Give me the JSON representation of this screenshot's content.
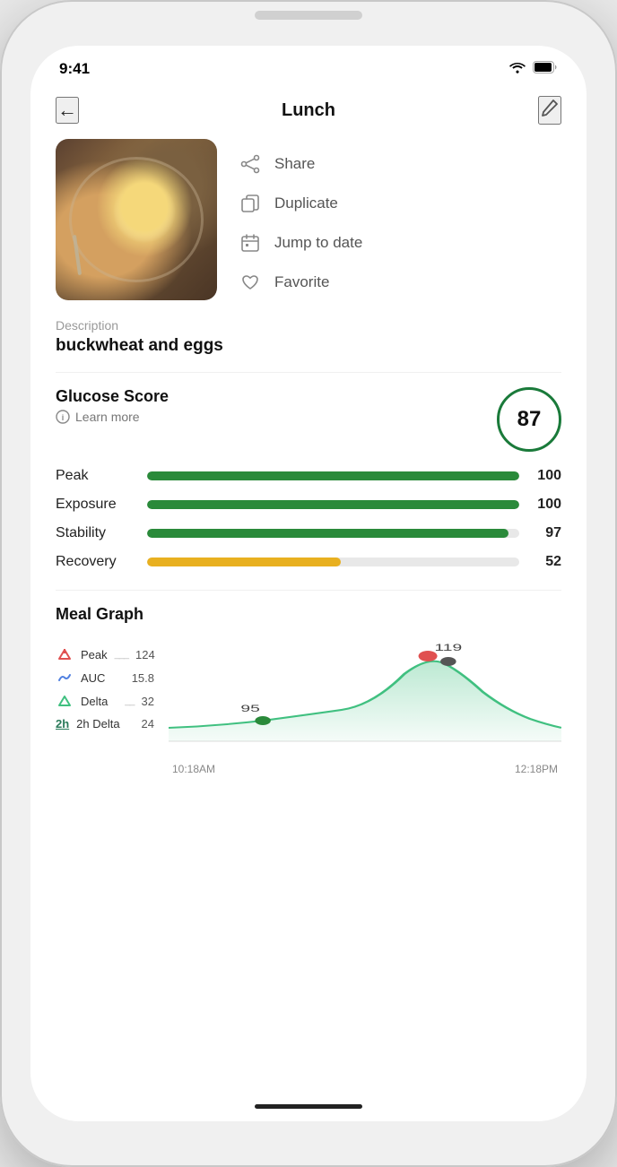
{
  "statusBar": {
    "time": "9:41"
  },
  "header": {
    "title": "Lunch",
    "backLabel": "←",
    "editLabel": "✏"
  },
  "actions": [
    {
      "id": "share",
      "label": "Share",
      "icon": "share"
    },
    {
      "id": "duplicate",
      "label": "Duplicate",
      "icon": "duplicate"
    },
    {
      "id": "jump-to-date",
      "label": "Jump to date",
      "icon": "calendar"
    },
    {
      "id": "favorite",
      "label": "Favorite",
      "icon": "heart"
    }
  ],
  "description": {
    "label": "Description",
    "text": "buckwheat and eggs"
  },
  "glucoseScore": {
    "title": "Glucose Score",
    "learnMore": "Learn more",
    "score": "87",
    "metrics": [
      {
        "label": "Peak",
        "value": 100,
        "maxValue": 100,
        "displayValue": "100",
        "color": "green"
      },
      {
        "label": "Exposure",
        "value": 100,
        "maxValue": 100,
        "displayValue": "100",
        "color": "green"
      },
      {
        "label": "Stability",
        "value": 97,
        "maxValue": 100,
        "displayValue": "97",
        "color": "green"
      },
      {
        "label": "Recovery",
        "value": 52,
        "maxValue": 100,
        "displayValue": "52",
        "color": "yellow"
      }
    ]
  },
  "mealGraph": {
    "title": "Meal Graph",
    "legend": [
      {
        "id": "peak",
        "label": "Peak",
        "value": "124",
        "type": "up-arrow",
        "color": "#e05050"
      },
      {
        "id": "auc",
        "label": "AUC",
        "value": "15.8",
        "type": "wave",
        "color": "#5080e0"
      },
      {
        "id": "delta",
        "label": "Delta",
        "value": "32",
        "type": "triangle",
        "color": "#40c080"
      },
      {
        "id": "2h-delta",
        "label": "2h Delta",
        "value": "24",
        "type": "2h",
        "color": "#2a7a5a"
      }
    ],
    "chart": {
      "startLabel": "10:18AM",
      "endLabel": "12:18PM",
      "startValue": "95",
      "peakValue": "119",
      "startY": 95,
      "peakY": 119
    }
  }
}
